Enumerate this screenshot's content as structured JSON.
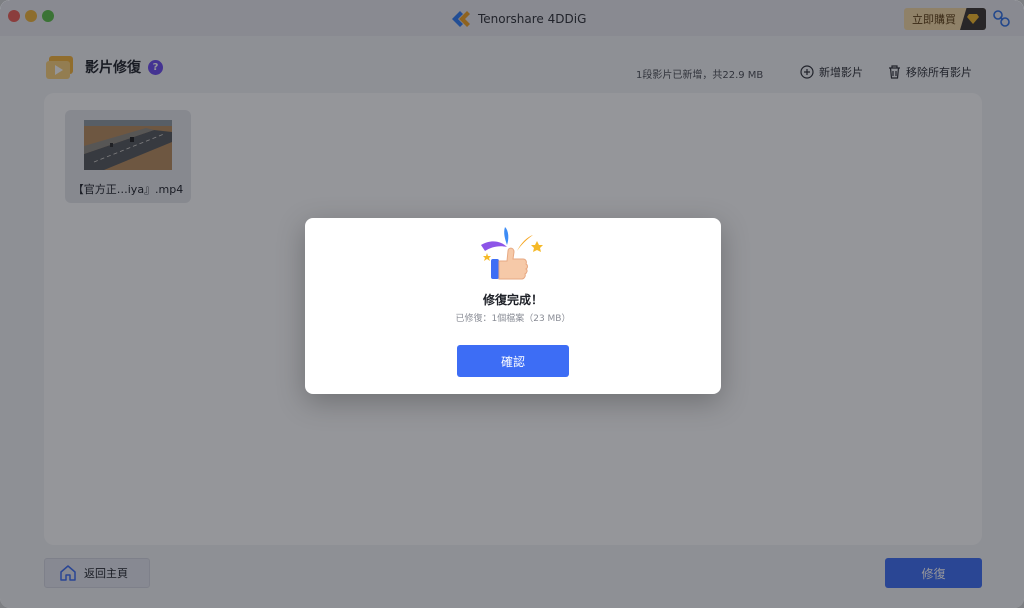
{
  "window": {
    "app_title": "Tenorshare 4DDiG",
    "buy_label": "立即購買"
  },
  "header": {
    "title": "影片修復",
    "help_glyph": "?",
    "added_info": "1段影片已新增，共22.9 MB",
    "add_video_label": "新增影片",
    "remove_all_label": "移除所有影片"
  },
  "files": [
    {
      "name": "【官方正…iya』.mp4"
    }
  ],
  "footer": {
    "home_label": "返回主頁",
    "repair_label": "修復"
  },
  "dialog": {
    "title": "修復完成！",
    "subtitle": "已修復：1個檔案（23 MB）",
    "confirm_label": "確認"
  },
  "icons": {
    "app_logo": "tenorshare-logo-icon",
    "gem": "gem-icon",
    "key": "key-icon",
    "video_repair": "video-repair-icon",
    "add": "plus-circle-icon",
    "trash": "trash-icon",
    "home": "home-icon",
    "celebration": "thumbs-up-celebration-icon"
  },
  "colors": {
    "accent": "#3d6df5",
    "help_badge": "#6c4cf0",
    "buy_bg": "#f5d9a4"
  }
}
